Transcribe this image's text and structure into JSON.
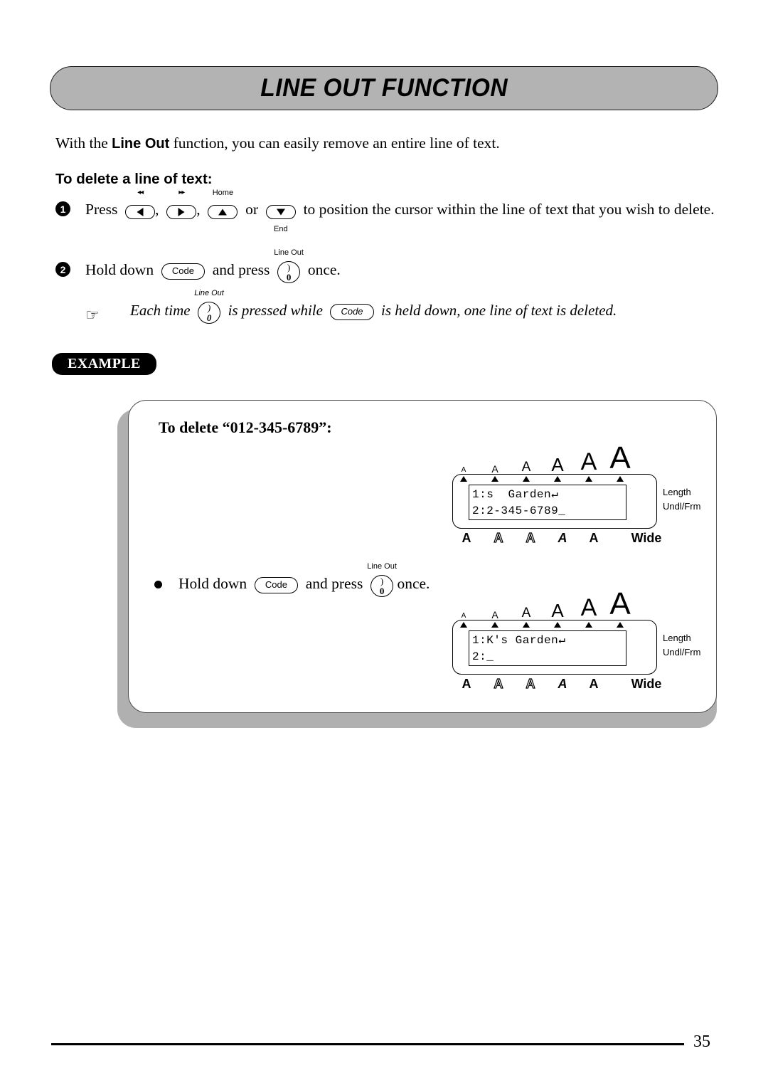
{
  "page": {
    "title": "LINE OUT FUNCTION",
    "number": "35"
  },
  "intro": {
    "before": "With the ",
    "bold": "Line Out",
    "after": " function, you can easily remove an entire line of text."
  },
  "subhead": "To delete a line of text:",
  "steps": [
    {
      "number": "1",
      "text_before": "Press",
      "text_mid": "or",
      "text_after": "to position the cursor within the line of text that you wish to delete.",
      "comma1": ",",
      "comma2": ","
    },
    {
      "number": "2",
      "text_before": "Hold down",
      "text_mid": "and press",
      "text_after": "once."
    }
  ],
  "keys": {
    "left": {
      "cap": "◂◂",
      "glyph": "left-arrow"
    },
    "right": {
      "cap": "▸▸",
      "glyph": "right-arrow"
    },
    "up": {
      "cap": "Home",
      "glyph": "up-arrow"
    },
    "down": {
      "cap": "End",
      "glyph": "down-arrow"
    },
    "code": {
      "label": "Code"
    },
    "line_out": {
      "cap": "Line Out",
      "top": ")",
      "bottom": "0"
    }
  },
  "note": {
    "hand_icon": "☞",
    "part1": "Each time",
    "part2": "is pressed while",
    "part3": "is held down, one line of text is deleted."
  },
  "example": {
    "badge": "EXAMPLE",
    "title": "To delete “012-345-6789”:",
    "step": {
      "before": "Hold down",
      "mid": "and press",
      "after": "once."
    }
  },
  "displays": [
    {
      "name": "before",
      "size_indicators": [
        "A",
        "A",
        "A",
        "A",
        "A",
        "A"
      ],
      "line1": "1:s  Garden↵",
      "line2": "2:2-345-6789_",
      "side_labels": [
        "Length",
        "Undl/Frm"
      ],
      "bottom_indicators": [
        "A",
        "A",
        "A",
        "A",
        "A",
        "Wide"
      ]
    },
    {
      "name": "after",
      "size_indicators": [
        "A",
        "A",
        "A",
        "A",
        "A",
        "A"
      ],
      "line1": "1:K's Garden↵",
      "line2": "2:_",
      "side_labels": [
        "Length",
        "Undl/Frm"
      ],
      "bottom_indicators": [
        "A",
        "A",
        "A",
        "A",
        "A",
        "Wide"
      ]
    }
  ],
  "colors": {
    "banner_gray": "#b3b3b3",
    "shadow_gray": "#b0b0b0",
    "box_border": "#4d4d4d",
    "ink": "#000000"
  }
}
